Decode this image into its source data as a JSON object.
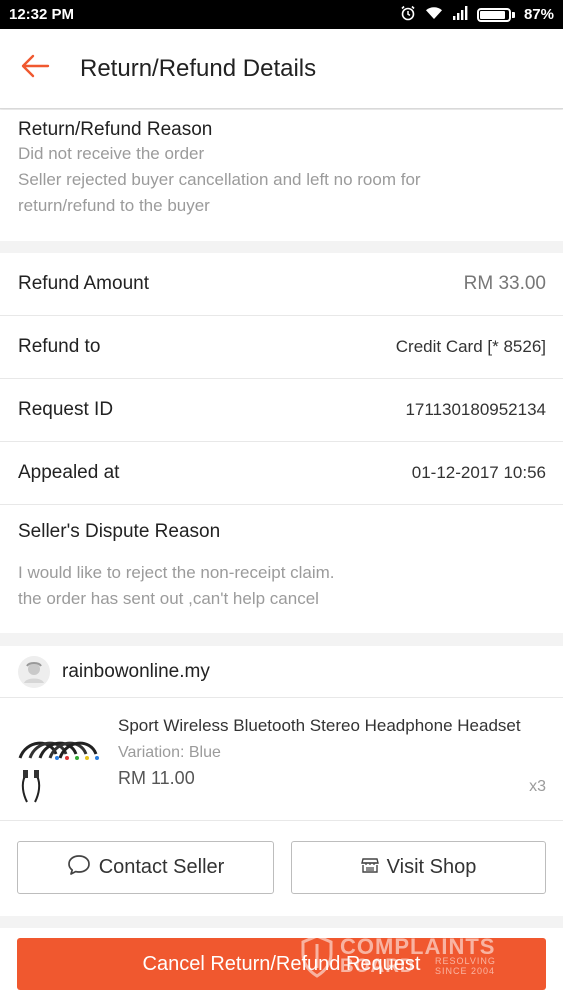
{
  "status_bar": {
    "time": "12:32 PM",
    "battery": "87%"
  },
  "header": {
    "title": "Return/Refund Details"
  },
  "reason": {
    "title": "Return/Refund Reason",
    "line1": "Did not receive the order",
    "line2": "Seller rejected buyer cancellation and left no room for",
    "line3": "return/refund to the buyer"
  },
  "details": {
    "refund_amount_label": "Refund Amount",
    "refund_amount_value": "RM 33.00",
    "refund_to_label": "Refund to",
    "refund_to_value": "Credit Card [* 8526]",
    "request_id_label": "Request ID",
    "request_id_value": "171130180952134",
    "appealed_label": "Appealed at",
    "appealed_value": "01-12-2017 10:56"
  },
  "dispute": {
    "title": "Seller's Dispute Reason",
    "line1": "I would like to reject the non-receipt claim.",
    "line2": "the order has sent out ,can't help cancel"
  },
  "shop": {
    "name": "rainbowonline.my"
  },
  "product": {
    "name": "Sport Wireless Bluetooth Stereo Headphone Headset",
    "variation": "Variation: Blue",
    "price": "RM 11.00",
    "quantity": "x3"
  },
  "actions": {
    "contact_seller": "Contact Seller",
    "visit_shop": "Visit Shop",
    "cancel_request": "Cancel Return/Refund Request"
  },
  "watermark": {
    "title": "COMPLAINTS",
    "subtitle": "BOARD",
    "tagline1": "RESOLVING",
    "tagline2": "SINCE 2004"
  },
  "colors": {
    "accent": "#f0582f",
    "muted_text": "#9b9b9b"
  },
  "icons": {
    "back": "arrow-left-icon",
    "chat": "chat-bubble-icon",
    "shop": "storefront-icon",
    "alarm": "alarm-icon",
    "wifi": "wifi-icon",
    "signal": "signal-icon",
    "battery": "battery-icon"
  }
}
